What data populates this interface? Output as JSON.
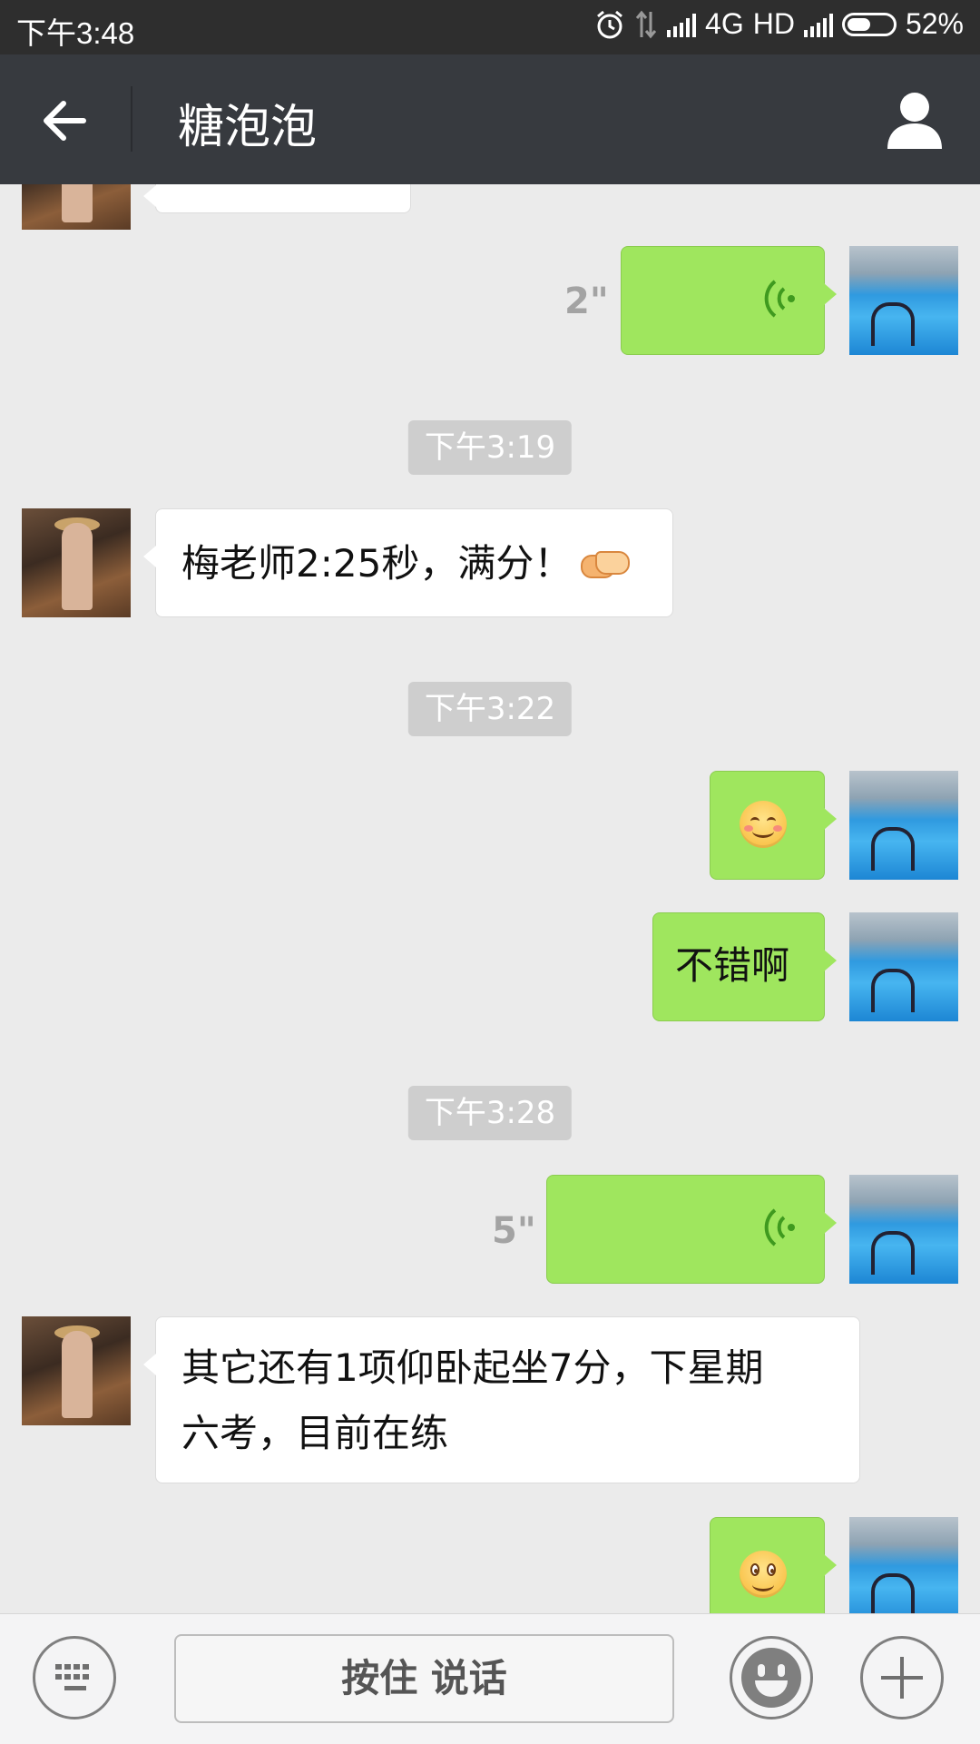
{
  "status_bar": {
    "time": "下午3:48",
    "network": "4G",
    "hd": "HD",
    "battery_percent_label": "52%",
    "battery_level": 0.52,
    "icons": [
      "alarm-icon",
      "data-arrows-icon",
      "signal-icon",
      "signal-icon",
      "battery-icon"
    ]
  },
  "header": {
    "title": "糖泡泡",
    "back_icon": "arrow-left-icon",
    "profile_icon": "person-icon"
  },
  "colors": {
    "header_bg": "#373a3f",
    "status_bg": "#2e2e2e",
    "chat_bg": "#ebebeb",
    "outgoing_bubble": "#9fe65e",
    "incoming_bubble": "#ffffff",
    "timestamp_pill": "#cecece"
  },
  "messages": [
    {
      "type": "voice",
      "direction": "out",
      "duration": "2\""
    },
    {
      "type": "timestamp",
      "text": "下午3:19"
    },
    {
      "type": "text",
      "direction": "in",
      "text": "梅老师2:25秒，满分！",
      "emoji": "handshake-emoji"
    },
    {
      "type": "timestamp",
      "text": "下午3:22"
    },
    {
      "type": "emoji",
      "direction": "out",
      "emoji": "smile-emoji"
    },
    {
      "type": "text",
      "direction": "out",
      "text": "不错啊"
    },
    {
      "type": "timestamp",
      "text": "下午3:28"
    },
    {
      "type": "voice",
      "direction": "out",
      "duration": "5\""
    },
    {
      "type": "text",
      "direction": "in",
      "lines": [
        "其它还有1项仰卧起坐7分，下星期",
        "六考，目前在练"
      ]
    },
    {
      "type": "emoji",
      "direction": "out",
      "emoji": "grin-emoji"
    }
  ],
  "input_bar": {
    "keyboard_icon": "keyboard-icon",
    "hold_to_talk_label": "按住 说话",
    "emoji_icon": "emoji-face-icon",
    "plus_icon": "plus-icon"
  }
}
